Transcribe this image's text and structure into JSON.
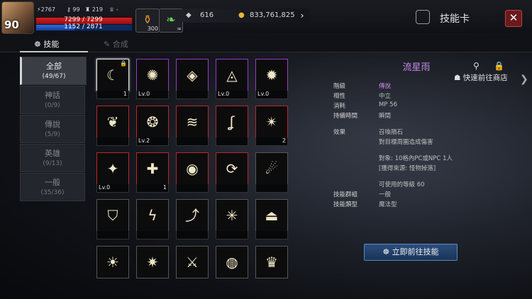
{
  "player": {
    "level": "90",
    "power": "2767",
    "stat1": "99",
    "stat2": "219",
    "stat3": "-",
    "hp_text": "7299 / 7299",
    "mp_text": "1152 / 2871",
    "hp_ratio": 1.0,
    "mp_ratio": 0.4
  },
  "slots": [
    {
      "name": "potion-slot",
      "count": "300"
    },
    {
      "name": "leaf-slot",
      "count": "∞"
    }
  ],
  "resources": {
    "crystals": "616",
    "gold": "833,761,825"
  },
  "header": {
    "title": "技能卡",
    "close": "✕"
  },
  "tabs": [
    {
      "label": "技能",
      "active": true
    },
    {
      "label": "合成",
      "active": false
    }
  ],
  "shop_link": "快速前往商店",
  "categories": [
    {
      "name": "全部",
      "count": "(49/67)",
      "active": true
    },
    {
      "name": "神話",
      "count": "(0/9)",
      "active": false
    },
    {
      "name": "傳說",
      "count": "(5/9)",
      "active": false
    },
    {
      "name": "英雄",
      "count": "(9/13)",
      "active": false
    },
    {
      "name": "一般",
      "count": "(35/36)",
      "active": false
    }
  ],
  "cards": [
    {
      "icon": "moon-swirl-icon",
      "glyph": "☾",
      "frame": "sel",
      "lv": "",
      "count": "1",
      "lock": true
    },
    {
      "icon": "flame-orb-icon",
      "glyph": "✺",
      "frame": "legend",
      "lv": "Lv.0",
      "count": "",
      "lock": false
    },
    {
      "icon": "prism-book-icon",
      "glyph": "◈",
      "frame": "legend",
      "lv": "",
      "count": "",
      "lock": false
    },
    {
      "icon": "eye-triangle-icon",
      "glyph": "◬",
      "frame": "legend",
      "lv": "Lv.0",
      "count": "",
      "lock": false
    },
    {
      "icon": "demon-face-icon",
      "glyph": "✹",
      "frame": "legend",
      "lv": "Lv.0",
      "count": "",
      "lock": false
    },
    {
      "icon": "wings-icon",
      "glyph": "❦",
      "frame": "hero",
      "lv": "",
      "count": "",
      "lock": false
    },
    {
      "icon": "lotus-emblem-icon",
      "glyph": "❂",
      "frame": "hero",
      "lv": "Lv.2",
      "count": "",
      "lock": false
    },
    {
      "icon": "wind-lines-icon",
      "glyph": "≋",
      "frame": "hero",
      "lv": "",
      "count": "",
      "lock": false
    },
    {
      "icon": "flame-curl-icon",
      "glyph": "ʆ",
      "frame": "hero",
      "lv": "",
      "count": "",
      "lock": false
    },
    {
      "icon": "vortex-icon",
      "glyph": "✴",
      "frame": "hero",
      "lv": "",
      "count": "2",
      "lock": false
    },
    {
      "icon": "fox-emblem-icon",
      "glyph": "✦",
      "frame": "hero",
      "lv": "Lv.0",
      "count": "",
      "lock": false
    },
    {
      "icon": "heal-cross-icon",
      "glyph": "✚",
      "frame": "hero",
      "lv": "",
      "count": "1",
      "lock": false
    },
    {
      "icon": "winged-eye-icon",
      "glyph": "◉",
      "frame": "hero",
      "lv": "",
      "count": "",
      "lock": false
    },
    {
      "icon": "cycle-emblem-icon",
      "glyph": "⟳",
      "frame": "hero",
      "lv": "",
      "count": "",
      "lock": false
    },
    {
      "icon": "mask-icon",
      "glyph": "☄",
      "frame": "normal",
      "lv": "",
      "count": "",
      "lock": false
    },
    {
      "icon": "shield-icon",
      "glyph": "⛉",
      "frame": "normal",
      "lv": "",
      "count": "",
      "lock": false
    },
    {
      "icon": "lightning-icon",
      "glyph": "ϟ",
      "frame": "normal",
      "lv": "",
      "count": "",
      "lock": false
    },
    {
      "icon": "arc-slash-icon",
      "glyph": "⤴",
      "frame": "normal",
      "lv": "",
      "count": "",
      "lock": false
    },
    {
      "icon": "shatter-icon",
      "glyph": "✳",
      "frame": "normal",
      "lv": "",
      "count": "",
      "lock": false
    },
    {
      "icon": "altar-icon",
      "glyph": "⏏",
      "frame": "normal",
      "lv": "",
      "count": "",
      "lock": false
    },
    {
      "icon": "sun-icon",
      "glyph": "☀",
      "frame": "normal",
      "lv": "",
      "count": "",
      "lock": false
    },
    {
      "icon": "gear-burst-icon",
      "glyph": "✷",
      "frame": "normal",
      "lv": "",
      "count": "",
      "lock": false
    },
    {
      "icon": "sword-icon",
      "glyph": "⚔",
      "frame": "normal",
      "lv": "",
      "count": "",
      "lock": false
    },
    {
      "icon": "orb-icon",
      "glyph": "◍",
      "frame": "normal",
      "lv": "",
      "count": "",
      "lock": false
    },
    {
      "icon": "crown-icon",
      "glyph": "♛",
      "frame": "normal",
      "lv": "",
      "count": "",
      "lock": false
    }
  ],
  "detail": {
    "name": "流星雨",
    "rows": [
      {
        "k": "階級",
        "v": "傳說",
        "purple": true
      },
      {
        "k": "相性",
        "v": "中立"
      },
      {
        "k": "消耗",
        "v": "MP 56"
      },
      {
        "k": "持續時間",
        "v": "瞬間"
      },
      {
        "k": "效果",
        "v": "召喚隕石"
      },
      {
        "k": "",
        "v": "對目標周圍造成傷害"
      },
      {
        "k": "",
        "v": "對象: 10格內PC或NPC 1人"
      },
      {
        "k": "",
        "v": "[獲得來源: 怪物掉落]"
      },
      {
        "k": "",
        "v": "可使用的等級 60"
      },
      {
        "k": "技能群組",
        "v": "一般"
      },
      {
        "k": "技能類型",
        "v": "魔法型"
      }
    ],
    "go_button": "立即前往技能"
  }
}
